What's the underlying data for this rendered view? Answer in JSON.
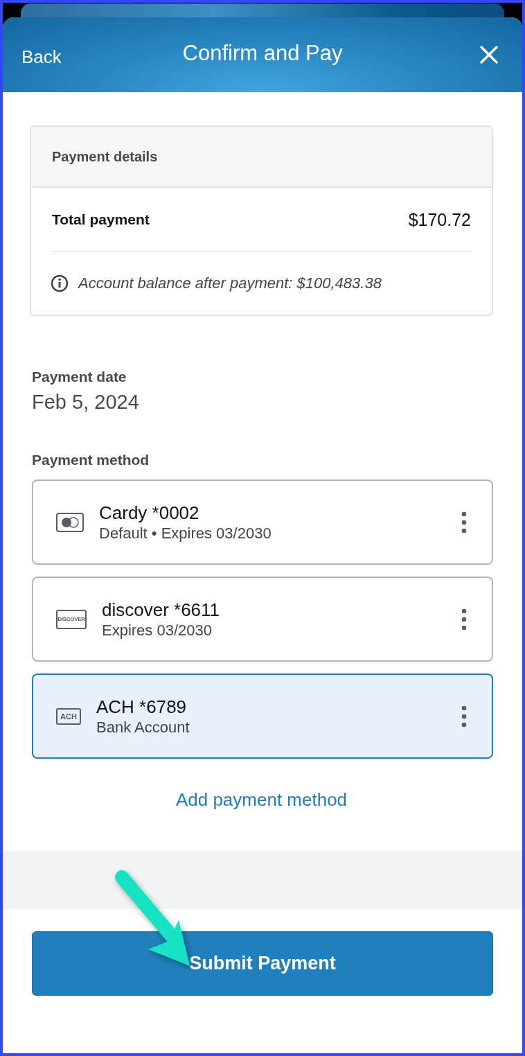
{
  "header": {
    "back": "Back",
    "title": "Confirm and Pay"
  },
  "details": {
    "title": "Payment details",
    "total_label": "Total payment",
    "total_value": "$170.72",
    "balance_note": "Account balance after payment: $100,483.38"
  },
  "payment_date": {
    "label": "Payment date",
    "value": "Feb 5, 2024"
  },
  "payment_method": {
    "label": "Payment method",
    "methods": [
      {
        "kind": "mastercard",
        "name": "Cardy *0002",
        "detail": "Default • Expires 03/2030",
        "selected": false
      },
      {
        "kind": "discover",
        "icon_text": "DISCOVER",
        "name": "discover *6611",
        "detail": "Expires 03/2030",
        "selected": false
      },
      {
        "kind": "ach",
        "icon_text": "ACH",
        "name": "ACH *6789",
        "detail": "Bank Account",
        "selected": true
      }
    ],
    "add_link": "Add payment method"
  },
  "submit_button": "Submit Payment"
}
